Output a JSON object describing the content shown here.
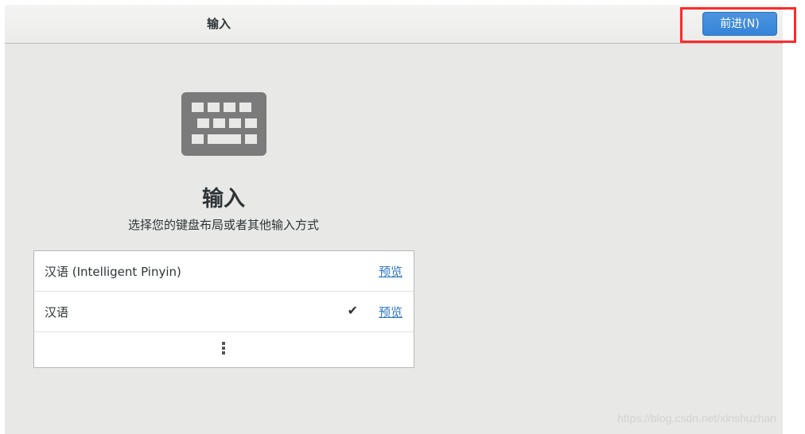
{
  "header": {
    "title": "输入",
    "next_label": "前进(N)"
  },
  "page": {
    "title": "输入",
    "subtitle": "选择您的键盘布局或者其他输入方式",
    "icon": "keyboard-icon"
  },
  "input_sources": [
    {
      "label": "汉语 (Intelligent Pinyin)",
      "preview_label": "预览",
      "selected": false
    },
    {
      "label": "汉语",
      "preview_label": "预览",
      "selected": true,
      "check_mark": "✔"
    }
  ],
  "more_icon": "more-vertical-icon",
  "watermark": "https://blog.csdn.net/xinshuzhan",
  "colors": {
    "accent": "#3584d9",
    "highlight": "#ff2a2a",
    "link": "#2a76c6"
  }
}
